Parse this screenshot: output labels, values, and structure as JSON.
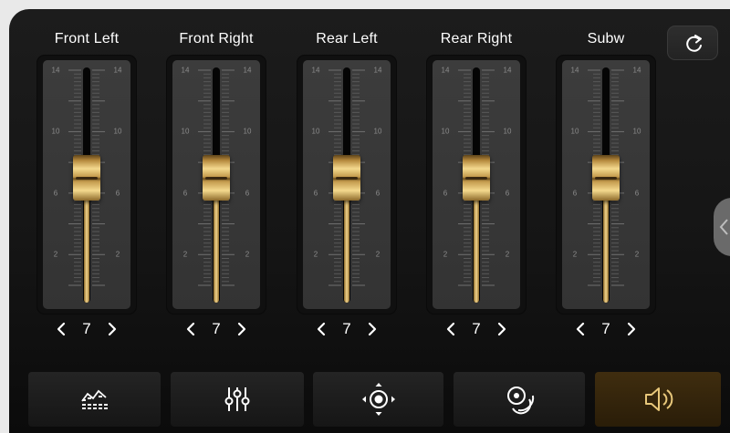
{
  "channels": [
    {
      "label": "Front Left",
      "value": "7",
      "level": 7
    },
    {
      "label": "Front Right",
      "value": "7",
      "level": 7
    },
    {
      "label": "Rear Left",
      "value": "7",
      "level": 7
    },
    {
      "label": "Rear Right",
      "value": "7",
      "level": 7
    },
    {
      "label": "Subw",
      "value": "7",
      "level": 7
    }
  ],
  "scale": {
    "min": 0,
    "max": 14,
    "major_ticks": [
      "14",
      "10",
      "6",
      "2"
    ]
  },
  "stepper": {
    "decrease_icon": "chevron-left-icon",
    "increase_icon": "chevron-right-icon"
  },
  "reset": {
    "icon": "refresh-icon"
  },
  "tabs": [
    {
      "icon": "equalizer-graph-icon",
      "active": false
    },
    {
      "icon": "mixer-sliders-icon",
      "active": false
    },
    {
      "icon": "balance-fader-icon",
      "active": false
    },
    {
      "icon": "surround-sound-icon",
      "active": false
    },
    {
      "icon": "speaker-volume-icon",
      "active": true
    }
  ],
  "colors": {
    "background": "#151515",
    "panel": "#3c3c3c",
    "gold": "#e8c77a",
    "active_tab": "#3f2d0f",
    "text": "#ffffff"
  }
}
